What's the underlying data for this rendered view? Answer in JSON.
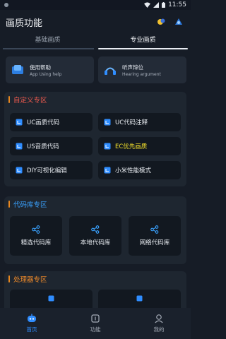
{
  "status_bar": {
    "time": "11:55"
  },
  "app_bar": {
    "title": "画质功能"
  },
  "tabs": [
    {
      "label": "基础画质",
      "active": false
    },
    {
      "label": "专业画质",
      "active": true
    }
  ],
  "help_cards": [
    {
      "title": "使用帮助",
      "subtitle": "App Using help",
      "icon": "help-book-icon"
    },
    {
      "title": "听声辩位",
      "subtitle": "Hearing argument",
      "icon": "headphone-icon"
    }
  ],
  "sections": {
    "custom": {
      "title": "自定义专区",
      "items": [
        {
          "label": "UC画质代码",
          "highlight": false
        },
        {
          "label": "UC代码注释",
          "highlight": false
        },
        {
          "label": "US音质代码",
          "highlight": false
        },
        {
          "label": "EC优先画质",
          "highlight": true
        },
        {
          "label": "DIY可视化编辑",
          "highlight": false
        },
        {
          "label": "小米性能模式",
          "highlight": false
        }
      ]
    },
    "library": {
      "title": "代码库专区",
      "items": [
        {
          "label": "精选代码库"
        },
        {
          "label": "本地代码库"
        },
        {
          "label": "网络代码库"
        }
      ]
    },
    "processor": {
      "title": "处理器专区"
    }
  },
  "bottom_nav": [
    {
      "label": "首页",
      "active": true,
      "icon": "home-robot-icon"
    },
    {
      "label": "功能",
      "active": false,
      "icon": "function-box-icon"
    },
    {
      "label": "我的",
      "active": false,
      "icon": "profile-icon"
    }
  ],
  "colors": {
    "background": "#161c26",
    "card": "#1e2630",
    "button": "#121820",
    "accent_blue": "#2f8dff",
    "custom_title": "#ef5a4e",
    "library_title": "#3aa2ff",
    "processor_title": "#ef8a2a",
    "highlight_text": "#f4e12b"
  }
}
